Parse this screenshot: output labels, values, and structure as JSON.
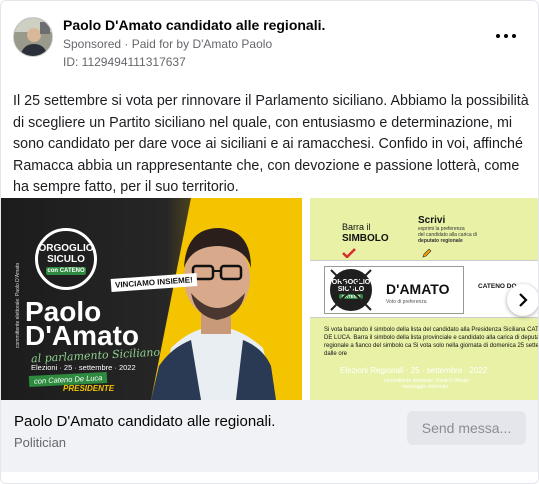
{
  "post": {
    "title": "Paolo D'Amato candidato alle regionali.",
    "sponsored_label": "Sponsored",
    "paid_for_prefix": "Paid for by",
    "paid_for_name": "D'Amato Paolo",
    "ad_id": "ID: 1129494111317637",
    "body": "Il 25 settembre si vota per rinnovare il Parlamento siciliano. Abbiamo la possibilità di scegliere un Partito siciliano nel quale, con entusiasmo e determinazione, mi sono candidato per dare voce ai siciliani e ai ramacchesi. Confido in voi, affinché Ramacca abbia un rappresentante che, con devozione e passione lotterà, come ha sempre fatto, per il suo territorio."
  },
  "slide1": {
    "logo_top": "ORGOGLIO",
    "logo_bottom": "SICULO",
    "logo_con": "con",
    "logo_cateno": "CATENO",
    "vinciamo": "VINCIAMO INSIEME!",
    "name_first": "Paolo",
    "name_last": "D'Amato",
    "script_line": "al parlamento Siciliano",
    "elezioni": "Elezioni · 25 · settembre · 2022",
    "con_cateno": "con Cateno De Luca",
    "presidente": "PRESIDENTE",
    "side_text": "committente elettorale: Paolo D'Amato"
  },
  "slide2": {
    "barra_il": "Barra il",
    "simbolo": "SIMBOLO",
    "scrivi": "Scrivi",
    "scrivi_sub1": "esprimi la preferenza",
    "scrivi_sub2": "del candidato alla carica di",
    "scrivi_sub3": "deputato regionale",
    "ballot_name": "D'AMATO",
    "voto_pref": "Voto di preferenza",
    "cateno_do": "CATENO DO",
    "info_text": "Si vota barrando il simbolo della lista del candidato alla Presidenza Siciliana CATENO DE LUCA. Barra il simbolo della lista provinciale e candidato alla carica di deputato regionale a fianco del simbolo ca Si vota solo nella giornata di domenica 25 settembre dalle ore",
    "elezioni": "Elezioni Regionali · 25 · settembre · 2022",
    "committente1": "committente elettorale: Paolo D'Amato",
    "committente2": "messaggio elettorale"
  },
  "footer": {
    "title": "Paolo D'Amato candidato alle regionali.",
    "category": "Politician",
    "cta": "Send messa..."
  },
  "colors": {
    "accent_green": "#2d8a3e",
    "lime_background": "#e8f1a6",
    "yellow": "#f2c200",
    "red_check": "#d32f2f"
  }
}
